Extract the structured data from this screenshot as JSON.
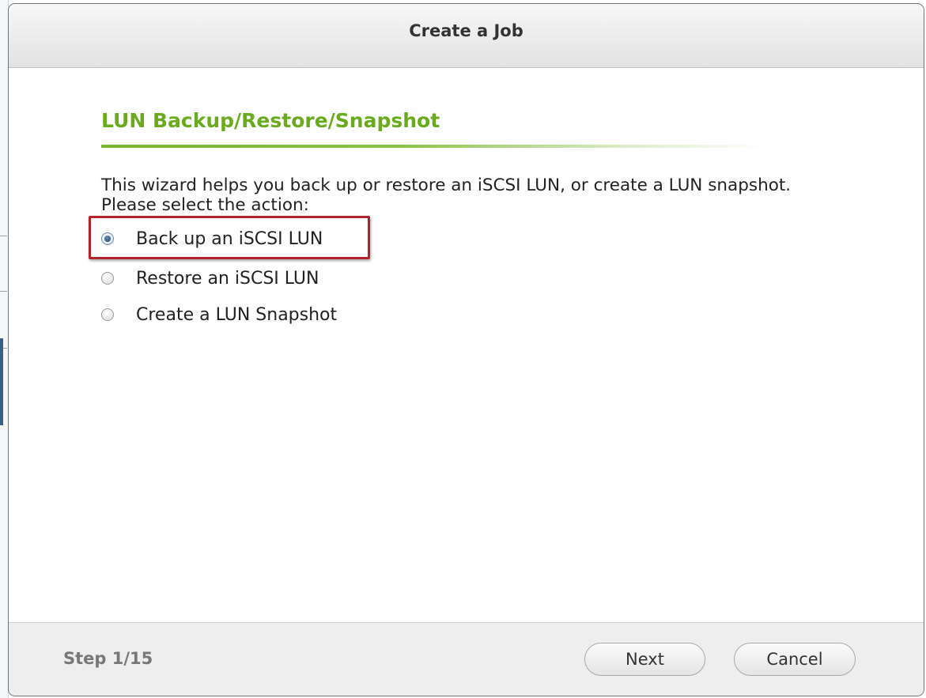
{
  "dialog": {
    "title": "Create a Job",
    "heading": "LUN Backup/Restore/Snapshot",
    "description": "This wizard helps you back up or restore an iSCSI LUN, or create a LUN snapshot. Please select the action:",
    "options": [
      {
        "label": "Back up an iSCSI LUN",
        "selected": true
      },
      {
        "label": "Restore an iSCSI LUN",
        "selected": false
      },
      {
        "label": "Create a LUN Snapshot",
        "selected": false
      }
    ],
    "footer": {
      "step": "Step 1/15",
      "next_label": "Next",
      "cancel_label": "Cancel"
    }
  },
  "colors": {
    "heading": "#6aab1e",
    "highlight_border": "#b0232a",
    "footer_bg": "#eeeeee"
  }
}
